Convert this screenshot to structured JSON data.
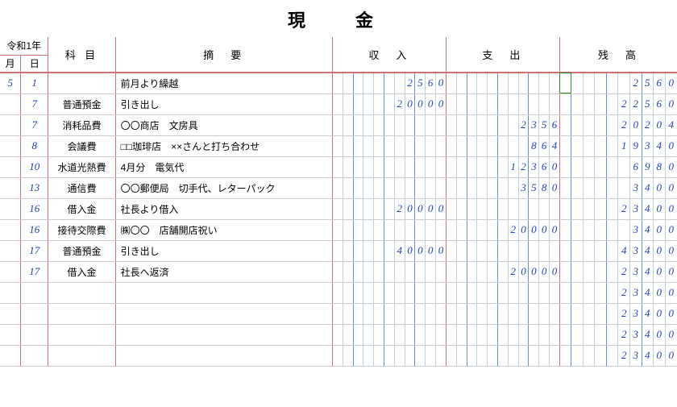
{
  "title": "現　金",
  "era": "令和1年",
  "headers": {
    "month": "月",
    "day": "日",
    "account": "科 目",
    "desc": "摘　要",
    "income": "収　入",
    "expense": "支　出",
    "balance": "残　高"
  },
  "rows": [
    {
      "month": "5",
      "day": "1",
      "account": "",
      "desc": "前月より繰越",
      "income": "2560",
      "expense": "",
      "balance": "2560"
    },
    {
      "month": "",
      "day": "7",
      "account": "普通預金",
      "desc": "引き出し",
      "income": "20000",
      "expense": "",
      "balance": "22560"
    },
    {
      "month": "",
      "day": "7",
      "account": "消耗品費",
      "desc": "〇〇商店　文房具",
      "income": "",
      "expense": "2356",
      "balance": "20204"
    },
    {
      "month": "",
      "day": "8",
      "account": "会議費",
      "desc": "□□珈琲店　××さんと打ち合わせ",
      "income": "",
      "expense": "864",
      "balance": "19340"
    },
    {
      "month": "",
      "day": "10",
      "account": "水道光熱費",
      "desc": "4月分　電気代",
      "income": "",
      "expense": "12360",
      "balance": "6980"
    },
    {
      "month": "",
      "day": "13",
      "account": "通信費",
      "desc": "〇〇郵便局　切手代、レターパック",
      "income": "",
      "expense": "3580",
      "balance": "3400"
    },
    {
      "month": "",
      "day": "16",
      "account": "借入金",
      "desc": "社長より借入",
      "income": "20000",
      "expense": "",
      "balance": "23400"
    },
    {
      "month": "",
      "day": "16",
      "account": "接待交際費",
      "desc": "㈱〇〇　店舗開店祝い",
      "income": "",
      "expense": "20000",
      "balance": "3400"
    },
    {
      "month": "",
      "day": "17",
      "account": "普通預金",
      "desc": "引き出し",
      "income": "40000",
      "expense": "",
      "balance": "43400"
    },
    {
      "month": "",
      "day": "17",
      "account": "借入金",
      "desc": "社長へ返済",
      "income": "",
      "expense": "20000",
      "balance": "23400"
    },
    {
      "month": "",
      "day": "",
      "account": "",
      "desc": "",
      "income": "",
      "expense": "",
      "balance": "23400"
    },
    {
      "month": "",
      "day": "",
      "account": "",
      "desc": "",
      "income": "",
      "expense": "",
      "balance": "23400"
    },
    {
      "month": "",
      "day": "",
      "account": "",
      "desc": "",
      "income": "",
      "expense": "",
      "balance": "23400"
    },
    {
      "month": "",
      "day": "",
      "account": "",
      "desc": "",
      "income": "",
      "expense": "",
      "balance": "23400"
    }
  ],
  "selected_cell": {
    "row": 0,
    "section": "balance",
    "digit": 0
  }
}
